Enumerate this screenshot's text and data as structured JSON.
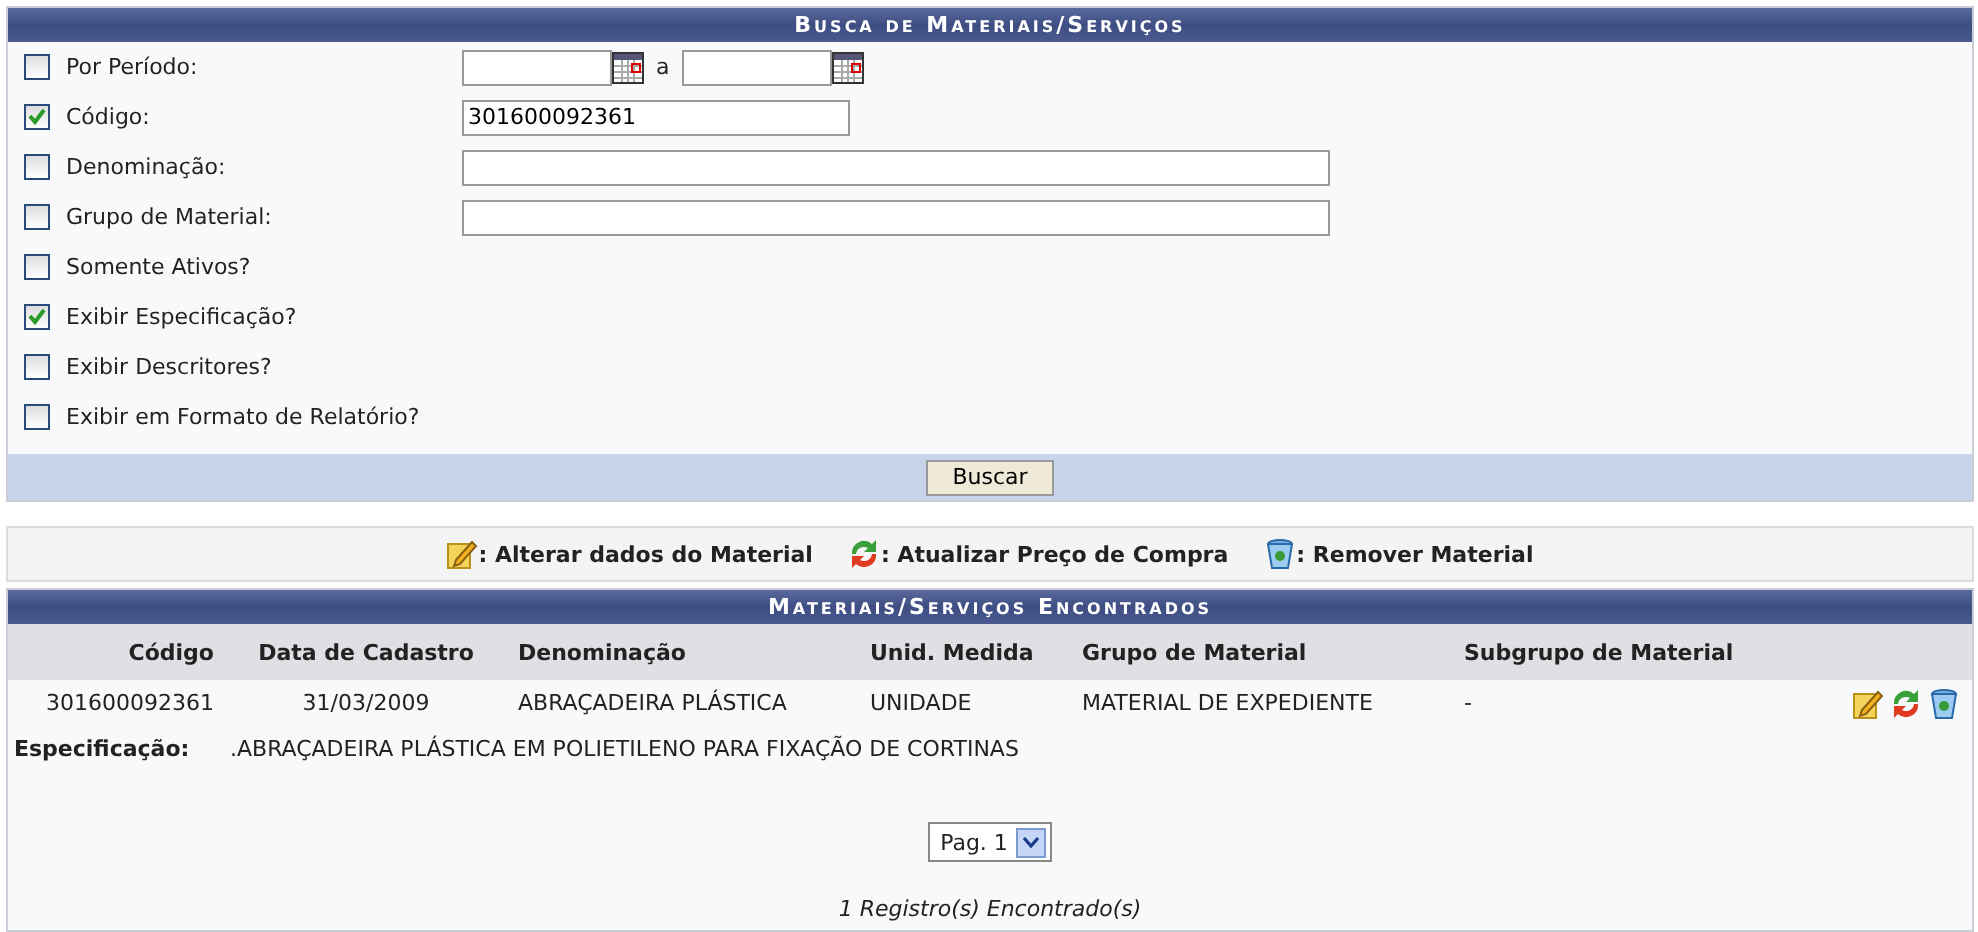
{
  "search_form": {
    "title": "Busca de Materiais/Serviços",
    "rows": [
      {
        "kind": "period",
        "label": "Por Período:",
        "checked": false,
        "separator": "a"
      },
      {
        "kind": "short_text",
        "label": "Código:",
        "checked": true,
        "value": "301600092361"
      },
      {
        "kind": "long_text",
        "label": "Denominação:",
        "checked": false
      },
      {
        "kind": "long_text",
        "label": "Grupo de Material:",
        "checked": false
      },
      {
        "kind": "check",
        "label": "Somente Ativos?",
        "checked": false
      },
      {
        "kind": "check",
        "label": "Exibir Especificação?",
        "checked": true
      },
      {
        "kind": "check",
        "label": "Exibir Descritores?",
        "checked": false
      },
      {
        "kind": "check",
        "label": "Exibir em Formato de Relatório?",
        "checked": false
      }
    ],
    "button": "Buscar"
  },
  "legend": [
    {
      "kind": "edit",
      "label": ": Alterar dados do Material"
    },
    {
      "kind": "refresh",
      "label": ": Atualizar Preço de Compra"
    },
    {
      "kind": "trash",
      "label": ": Remover Material"
    }
  ],
  "results": {
    "title": "Materiais/Serviços Encontrados",
    "columns": [
      "Código",
      "Data de Cadastro",
      "Denominação",
      "Unid. Medida",
      "Grupo de Material",
      "Subgrupo de Material"
    ],
    "rows": [
      {
        "cells": [
          "301600092361",
          "31/03/2009",
          "ABRAÇADEIRA PLÁSTICA",
          "UNIDADE",
          "MATERIAL DE EXPEDIENTE",
          "-"
        ],
        "actions": [
          {
            "kind": "edit"
          },
          {
            "kind": "refresh"
          },
          {
            "kind": "trash"
          }
        ],
        "spec_label": "Especificação:",
        "spec": ".ABRAÇADEIRA PLÁSTICA EM POLIETILENO PARA FIXAÇÃO DE CORTINAS"
      }
    ],
    "page": "Pag. 1",
    "footer": "1 Registro(s) Encontrado(s)"
  }
}
